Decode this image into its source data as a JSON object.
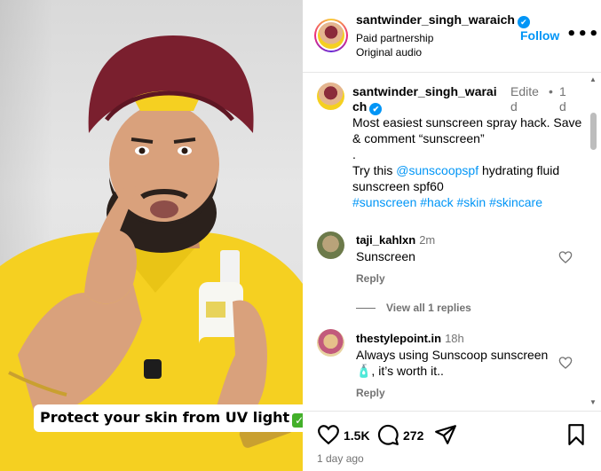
{
  "media": {
    "overlay_caption": "Protect your skin from UV light",
    "check_icon": "check-emoji-icon"
  },
  "header": {
    "username": "santwinder_singh_waraich",
    "subtitle1": "Paid partnership",
    "subtitle2": "Original audio",
    "follow_label": "Follow",
    "more_label": "•••"
  },
  "caption": {
    "username": "santwinder_singh_waraich",
    "edited": "Edited",
    "dot": "•",
    "time": "1d",
    "line1": "Most easiest sunscreen spray hack. Save & comment “sunscreen”",
    "line2": ".",
    "try_prefix": "Try this ",
    "mention": "@sunscoopspf",
    "try_suffix": " hydrating fluid sunscreen spf60",
    "hashtags": "#sunscreen #hack #skin #skincare"
  },
  "comments": [
    {
      "username": "taji_kahlxn",
      "time": "2m",
      "text": "Sunscreen",
      "reply_label": "Reply"
    },
    {
      "username": "thestylepoint.in",
      "time": "18h",
      "text": "Always using Sunscoop sunscreen 🧴, it’s worth it..",
      "reply_label": "Reply"
    }
  ],
  "view_replies": "View all 1 replies",
  "actions": {
    "likes": "1.5K",
    "comments": "272",
    "time_ago": "1 day ago"
  },
  "colors": {
    "accent": "#0095f6",
    "muted": "#737373",
    "shirt": "#f5d021",
    "turban": "#7a1f2e"
  }
}
